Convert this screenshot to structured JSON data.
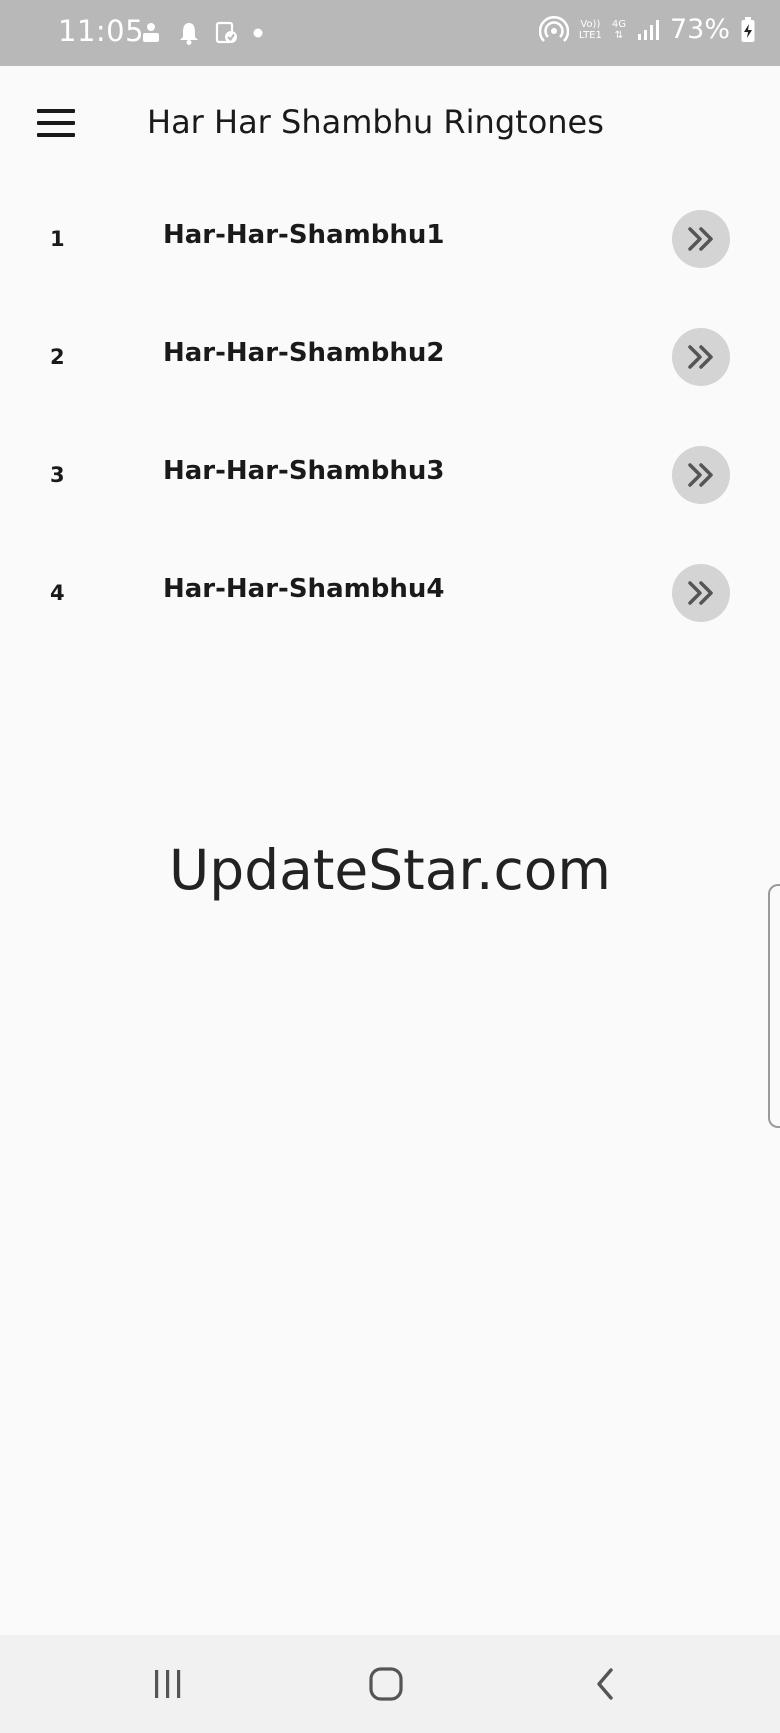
{
  "status_bar": {
    "time": "11:05",
    "network_top": "Vo))",
    "network_bottom": "LTE1",
    "network_type": "4G",
    "battery_percent": "73%"
  },
  "app_bar": {
    "title": "Har Har Shambhu Ringtones",
    "menu_icon": "hamburger-menu-icon"
  },
  "ringtones": [
    {
      "number": "1",
      "title": "Har-Har-Shambhu1"
    },
    {
      "number": "2",
      "title": "Har-Har-Shambhu2"
    },
    {
      "number": "3",
      "title": "Har-Har-Shambhu3"
    },
    {
      "number": "4",
      "title": "Har-Har-Shambhu4"
    }
  ],
  "watermark": "UpdateStar.com",
  "nav_bar": {
    "icons": [
      "recent-apps-icon",
      "home-icon",
      "back-icon"
    ]
  },
  "colors": {
    "status_bar": "#b8b8b8",
    "background": "#fafafa",
    "button": "#d4d4d4",
    "nav_bar": "#f1f1f1"
  }
}
